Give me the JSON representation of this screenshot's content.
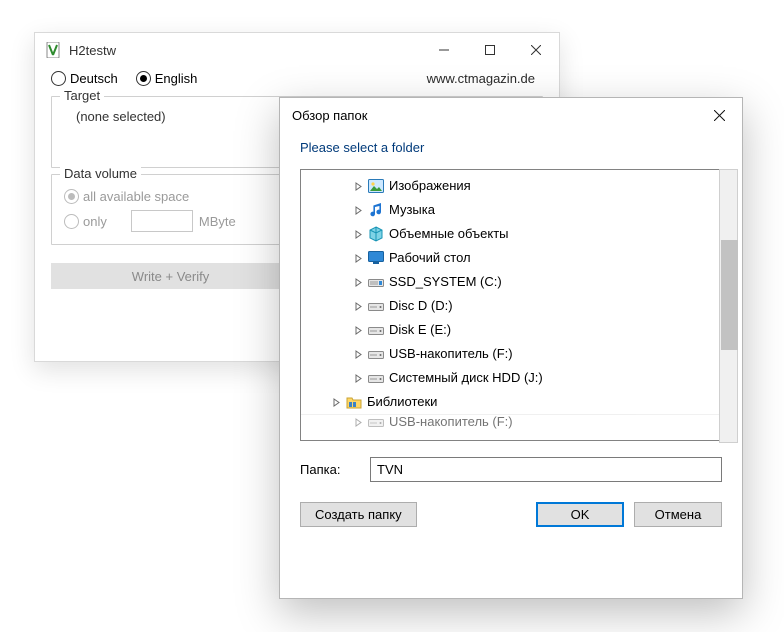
{
  "back": {
    "title": "H2testw",
    "lang": {
      "deutsch": "Deutsch",
      "english": "English",
      "selected": "english"
    },
    "link": "www.ctmagazin.de",
    "target": {
      "legend": "Target",
      "value": "(none selected)"
    },
    "datavol": {
      "legend": "Data volume",
      "all_label": "all available space",
      "only_label": "only",
      "unit": "MByte"
    },
    "buttons": {
      "write_verify": "Write + Verify",
      "second": ""
    }
  },
  "dlg": {
    "title": "Обзор папок",
    "prompt": "Please select a folder",
    "tree": [
      {
        "level": 2,
        "icon": "pictures",
        "label": "Изображения"
      },
      {
        "level": 2,
        "icon": "music",
        "label": "Музыка"
      },
      {
        "level": 2,
        "icon": "3d",
        "label": "Объемные объекты"
      },
      {
        "level": 2,
        "icon": "desktop",
        "label": "Рабочий стол"
      },
      {
        "level": 2,
        "icon": "drive-ssd",
        "label": "SSD_SYSTEM (C:)"
      },
      {
        "level": 2,
        "icon": "drive",
        "label": "Disc D (D:)"
      },
      {
        "level": 2,
        "icon": "drive",
        "label": "Disk E (E:)"
      },
      {
        "level": 2,
        "icon": "drive",
        "label": "USB-накопитель (F:)"
      },
      {
        "level": 2,
        "icon": "drive",
        "label": "Системный диск HDD (J:)"
      },
      {
        "level": 1,
        "icon": "libraries",
        "label": "Библиотеки"
      },
      {
        "level": 2,
        "icon": "drive",
        "label": "USB-накопитель (F:)",
        "cut": true
      }
    ],
    "folder_label": "Папка:",
    "folder_value": "TVN",
    "buttons": {
      "new_folder": "Создать папку",
      "ok": "OK",
      "cancel": "Отмена"
    }
  }
}
